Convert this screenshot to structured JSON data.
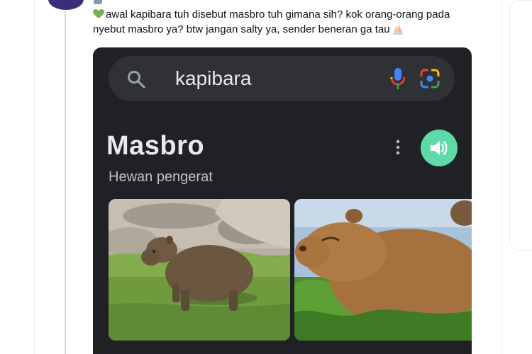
{
  "tweet": {
    "text": "awal kapibara tuh disebut masbro tuh gimana sih? kok orang-orang pada nyebut masbro ya? btw jangan salty ya, sender beneran ga tau",
    "leading_emoji": "green-heart-icon",
    "trailing_emoji": "folded-hands-icon"
  },
  "search": {
    "query": "kapibara",
    "icons": [
      "search-icon",
      "mic-icon",
      "lens-icon"
    ]
  },
  "knowledge_panel": {
    "title": "Masbro",
    "subtitle": "Hewan pengerat",
    "actions": [
      "more-vert-icon",
      "speaker-icon"
    ],
    "accent": "#5fd9a8"
  },
  "images": [
    "capybara-photo-standing",
    "capybara-photo-closeup"
  ]
}
